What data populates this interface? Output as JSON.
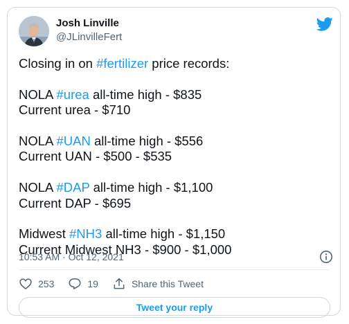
{
  "author": {
    "name": "Josh Linville",
    "handle": "@JLinvilleFert"
  },
  "icons": {
    "brand": "twitter-bird-icon",
    "info": "info-icon",
    "like": "heart-icon",
    "reply": "reply-icon",
    "share": "share-icon"
  },
  "colors": {
    "accent": "#1d9bf0",
    "text": "#0f1419",
    "muted": "#536471",
    "border": "#cfd9de"
  },
  "tweet": {
    "lines": [
      [
        {
          "t": "Closing in on "
        },
        {
          "t": "#fertilizer",
          "h": true
        },
        {
          "t": " price records:"
        }
      ],
      [],
      [
        {
          "t": "NOLA "
        },
        {
          "t": "#urea",
          "h": true
        },
        {
          "t": " all-time high - $835"
        }
      ],
      [
        {
          "t": "Current urea - $710"
        }
      ],
      [],
      [
        {
          "t": "NOLA "
        },
        {
          "t": "#UAN",
          "h": true
        },
        {
          "t": " all-time high - $556"
        }
      ],
      [
        {
          "t": "Current UAN - $500 - $535"
        }
      ],
      [],
      [
        {
          "t": "NOLA "
        },
        {
          "t": "#DAP",
          "h": true
        },
        {
          "t": " all-time high - $1,100"
        }
      ],
      [
        {
          "t": "Current DAP - $695"
        }
      ],
      [],
      [
        {
          "t": "Midwest "
        },
        {
          "t": "#NH3",
          "h": true
        },
        {
          "t": " all-time high - $1,150"
        }
      ],
      [
        {
          "t": "Current Midwest NH3 - $900 - $1,000"
        }
      ]
    ],
    "timestamp": "10:53 AM · Oct 12, 2021"
  },
  "actions": {
    "likes": "253",
    "replies": "19",
    "share_label": "Share this Tweet"
  },
  "reply_button": "Tweet your reply"
}
